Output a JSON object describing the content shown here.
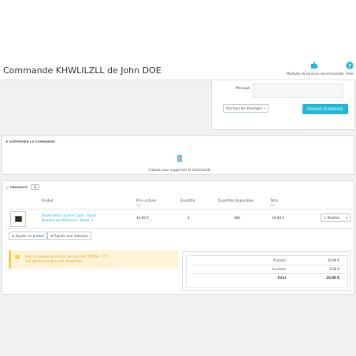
{
  "header": {
    "title": "Commande KHWLILZLL de John DOE",
    "toolbar": {
      "modules_label": "Modules et services recommandés",
      "help_label": "Aide"
    }
  },
  "messages": {
    "label": "Message",
    "view_all": "Voir tous les messages",
    "send": "ENVOYER LE MESSAGE"
  },
  "delete_order": {
    "heading": "SUPPRIMER LA COMMANDE",
    "click_text": "Cliquez pour supprimer la commande"
  },
  "products": {
    "heading": "PRODUITS",
    "count": "1",
    "columns": {
      "product": "Produit",
      "unit_price": "Prix unitaire",
      "unit_price_note": "TTC",
      "quantity": "Quantité",
      "available": "Quantités disponibles",
      "total": "Total",
      "total_note": "TTC"
    },
    "rows": [
      {
        "name": "Brown bear cushion Color : Black",
        "reference": "Numéro de référence : demo_1",
        "unit_price": "10,90 €",
        "quantity": "1",
        "available": "300",
        "total": "10,90 €"
      }
    ],
    "modify_label": "Modifier",
    "add_product": "Ajouter un produit",
    "add_discount": "Ajouter une réduction"
  },
  "alert": {
    "line1": "Pour ce groupe de clients, les prix sont affichés : TTC",
    "line2": "Les retours produits sont désactivés"
  },
  "totals": {
    "products_label": "Produits",
    "products_value": "10,90 €",
    "shipping_label": "Livraison",
    "shipping_value": "2,00 €",
    "total_label": "Total",
    "total_value": "20,90 €"
  },
  "colors": {
    "accent": "#25b9d7",
    "warning": "#fcc94f",
    "background": "#eff1f2"
  }
}
